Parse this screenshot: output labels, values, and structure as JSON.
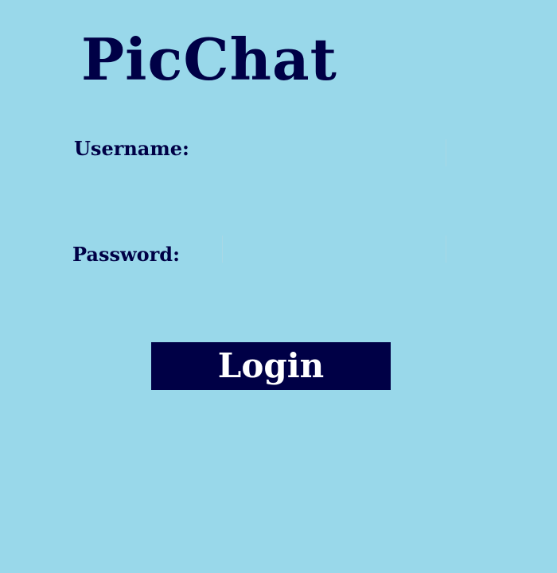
{
  "app": {
    "title": "PicChat"
  },
  "form": {
    "username_label": "Username:",
    "username_value": "",
    "password_label": "Password:",
    "password_value": "",
    "login_label": "Login"
  },
  "colors": {
    "background": "#99d8ea",
    "accent": "#000046",
    "button_text": "#ffffff"
  }
}
